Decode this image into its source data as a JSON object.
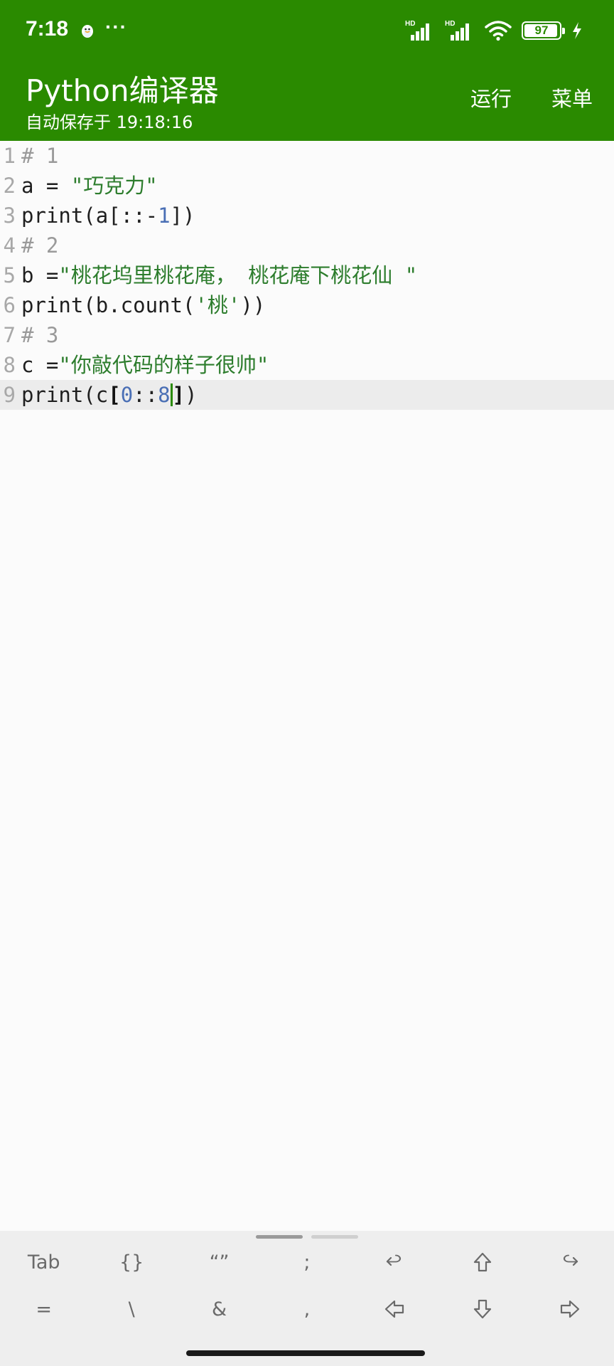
{
  "status_bar": {
    "time": "7:18",
    "notification_icon": "qq-penguin-icon",
    "more": "···",
    "signal_1_label": "HD",
    "signal_2_label": "HD",
    "battery_level": "97"
  },
  "app_bar": {
    "title": "Python编译器",
    "subtitle": "自动保存于 19:18:16",
    "run_label": "运行",
    "menu_label": "菜单",
    "background_color": "#2a8a00"
  },
  "editor": {
    "line_numbers": [
      "1",
      "2",
      "3",
      "4",
      "5",
      "6",
      "7",
      "8",
      "9"
    ],
    "current_line": 9,
    "cursor_after": "print(c[0::8"
  },
  "shortcuts": {
    "row1": [
      {
        "label": "Tab"
      },
      {
        "label": "{}"
      },
      {
        "label": "“”"
      },
      {
        "label": ";"
      },
      {
        "icon": "undo-icon"
      },
      {
        "icon": "arrow-up-icon"
      },
      {
        "icon": "redo-icon"
      }
    ],
    "row2": [
      {
        "label": "="
      },
      {
        "label": "\\"
      },
      {
        "label": "&"
      },
      {
        "label": ","
      },
      {
        "icon": "arrow-left-icon"
      },
      {
        "icon": "arrow-down-icon"
      },
      {
        "icon": "arrow-right-icon"
      }
    ],
    "active_page": 1,
    "page_count": 2
  },
  "code": [
    [
      {
        "t": "# 1",
        "k": "comment"
      }
    ],
    [
      {
        "t": "a = ",
        "k": "plain"
      },
      {
        "t": "\"巧克力\"",
        "k": "string"
      }
    ],
    [
      {
        "t": "print(a[::-",
        "k": "plain"
      },
      {
        "t": "1",
        "k": "number"
      },
      {
        "t": "])",
        "k": "plain"
      }
    ],
    [
      {
        "t": "# 2",
        "k": "comment"
      }
    ],
    [
      {
        "t": "b =",
        "k": "plain"
      },
      {
        "t": "\"桃花坞里桃花庵， 桃花庵下桃花仙 \"",
        "k": "string"
      }
    ],
    [
      {
        "t": "print(b.count(",
        "k": "plain"
      },
      {
        "t": "'桃'",
        "k": "string"
      },
      {
        "t": "))",
        "k": "plain"
      }
    ],
    [
      {
        "t": "# 3",
        "k": "comment"
      }
    ],
    [
      {
        "t": "c =",
        "k": "plain"
      },
      {
        "t": "\"你敲代码的样子很帅\"",
        "k": "string"
      }
    ],
    [
      {
        "t": "print(c",
        "k": "plain"
      },
      {
        "t": "[",
        "k": "bold"
      },
      {
        "t": "0",
        "k": "number"
      },
      {
        "t": "::",
        "k": "plain"
      },
      {
        "t": "8",
        "k": "number"
      },
      {
        "t": "|",
        "k": "cursor"
      },
      {
        "t": "]",
        "k": "bold"
      },
      {
        "t": ")",
        "k": "plain"
      }
    ]
  ]
}
